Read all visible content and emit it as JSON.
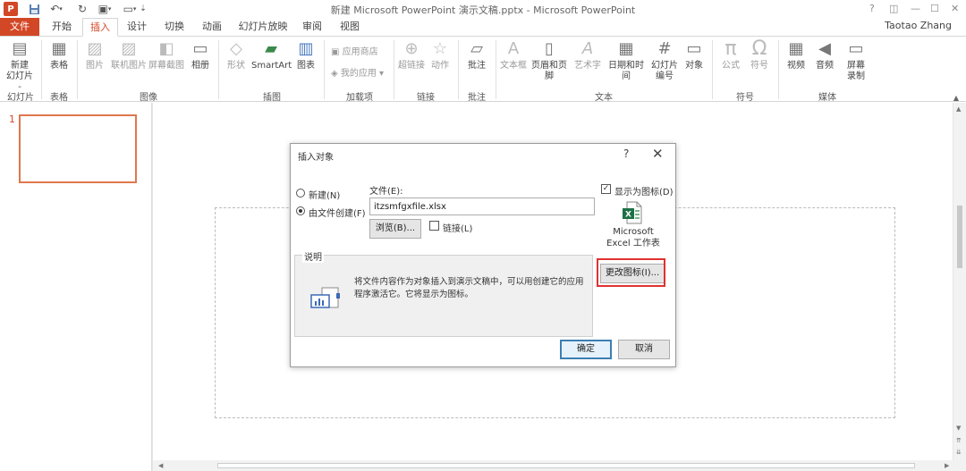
{
  "titlebar": {
    "app_logo": "P",
    "window_title": "新建 Microsoft PowerPoint 演示文稿.pptx - Microsoft PowerPoint",
    "help": "?",
    "restore": "◫",
    "minimize": "—",
    "maximize": "☐",
    "close": "✕",
    "icons": [
      "save-icon",
      "undo-icon",
      "redo-icon",
      "presentation-icon",
      "customize-icon"
    ]
  },
  "tabs": [
    {
      "label": "文件"
    },
    {
      "label": "开始"
    },
    {
      "label": "插入"
    },
    {
      "label": "设计"
    },
    {
      "label": "切换"
    },
    {
      "label": "动画"
    },
    {
      "label": "幻灯片放映"
    },
    {
      "label": "审阅"
    },
    {
      "label": "视图"
    }
  ],
  "active_tab": "插入",
  "user": "Taotao Zhang",
  "ribbon": {
    "new_slide": "新建\n幻灯片 -",
    "table": "表格",
    "picture": "图片",
    "online_picture": "联机图片",
    "screenshot": "屏幕截图",
    "album": "相册",
    "shapes": "形状",
    "smartart": "SmartArt",
    "chart": "图表",
    "store": "应用商店",
    "my_apps": "我的应用",
    "hyperlink": "超链接",
    "action": "动作",
    "comment": "批注",
    "textbox": "文本框",
    "header_footer": "页眉和页脚",
    "wordart": "艺术字",
    "date_time": "日期和时间",
    "slide_number": "幻灯片\n编号",
    "object": "对象",
    "equation": "公式",
    "symbol": "符号",
    "video": "视频",
    "audio": "音频",
    "screen_recording": "屏幕\n录制",
    "groups": {
      "slides": "幻灯片",
      "tables": "表格",
      "images": "图像",
      "illustrations": "插图",
      "addins": "加载项",
      "links": "链接",
      "comments": "批注",
      "text": "文本",
      "symbols": "符号",
      "media": "媒体"
    }
  },
  "thumbs": {
    "slide_number": "1"
  },
  "dialog": {
    "title": "插入对象",
    "help": "?",
    "close": "✕",
    "radio_new": "新建(N)",
    "radio_from_file": "由文件创建(F)",
    "selected_option": "由文件创建(F)",
    "file_label": "文件(E):",
    "file_value": "itzsmfgxfile.xlsx",
    "browse": "浏览(B)...",
    "link_label": "链接(L)",
    "link_checked": false,
    "show_as_icon_label": "显示为图标(D)",
    "show_as_icon_checked": true,
    "icon_caption": "Microsoft Excel 工作表",
    "change_icon": "更改图标(I)...",
    "result_legend": "说明",
    "result_text": "将文件内容作为对象插入到演示文稿中，可以用创建它的应用程序激活它。它将显示为图标。",
    "ok": "确定",
    "cancel": "取消"
  },
  "colors": {
    "accent": "#d24726",
    "highlight": "#e03131",
    "excel_green": "#1e7145",
    "ok_border": "#3c7fb1"
  }
}
